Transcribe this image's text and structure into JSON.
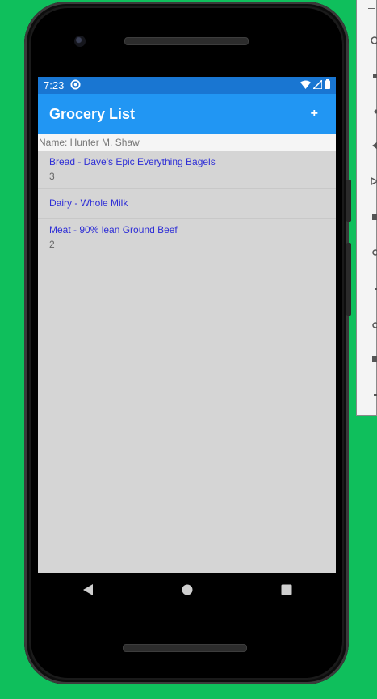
{
  "status_bar": {
    "time": "7:23"
  },
  "app_bar": {
    "title": "Grocery List",
    "add_label": "+"
  },
  "name_line": "Name: Hunter M. Shaw",
  "items": [
    {
      "title": "Bread - Dave's Epic Everything Bagels",
      "quantity": "3"
    },
    {
      "title": "Dairy - Whole Milk",
      "quantity": ""
    },
    {
      "title": "Meat - 90% lean Ground Beef",
      "quantity": "2"
    }
  ],
  "colors": {
    "background": "#0fbf5c",
    "status_bar": "#1976d2",
    "app_bar": "#2196f3",
    "item_title": "#2e2ed6",
    "list_background": "#d5d5d5"
  },
  "icons": {
    "status": [
      "sync-icon",
      "wifi-icon",
      "signal-icon",
      "battery-icon"
    ],
    "nav": [
      "back-icon",
      "home-icon",
      "recents-icon"
    ]
  }
}
